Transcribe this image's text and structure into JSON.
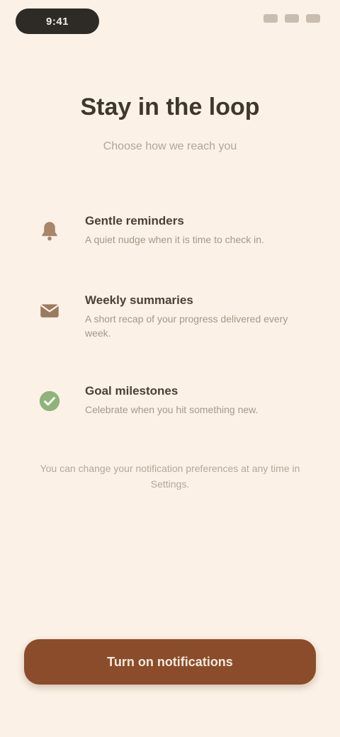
{
  "status_bar": {
    "time": "9:41",
    "icons": [
      "signal-icon",
      "wifi-icon",
      "battery-icon"
    ]
  },
  "header": {
    "title": "Stay in the loop",
    "subtitle": "Choose how we reach you"
  },
  "features": [
    {
      "icon": "bell-icon",
      "color": "#a8866a",
      "title": "Gentle reminders",
      "desc": "A quiet nudge when it is time to check in."
    },
    {
      "icon": "envelope-icon",
      "color": "#9b7a5e",
      "title": "Weekly summaries",
      "desc": "A short recap of your progress delivered every week."
    },
    {
      "icon": "check-icon",
      "color": "#8fb37a",
      "title": "Goal milestones",
      "desc": "Celebrate when you hit something new."
    }
  ],
  "note": "You can change your notification preferences at any time in Settings.",
  "cta": {
    "label": "Turn on notifications"
  },
  "colors": {
    "background": "#fbf1e6",
    "accent": "#8a4c2a",
    "success": "#8fb37a"
  }
}
